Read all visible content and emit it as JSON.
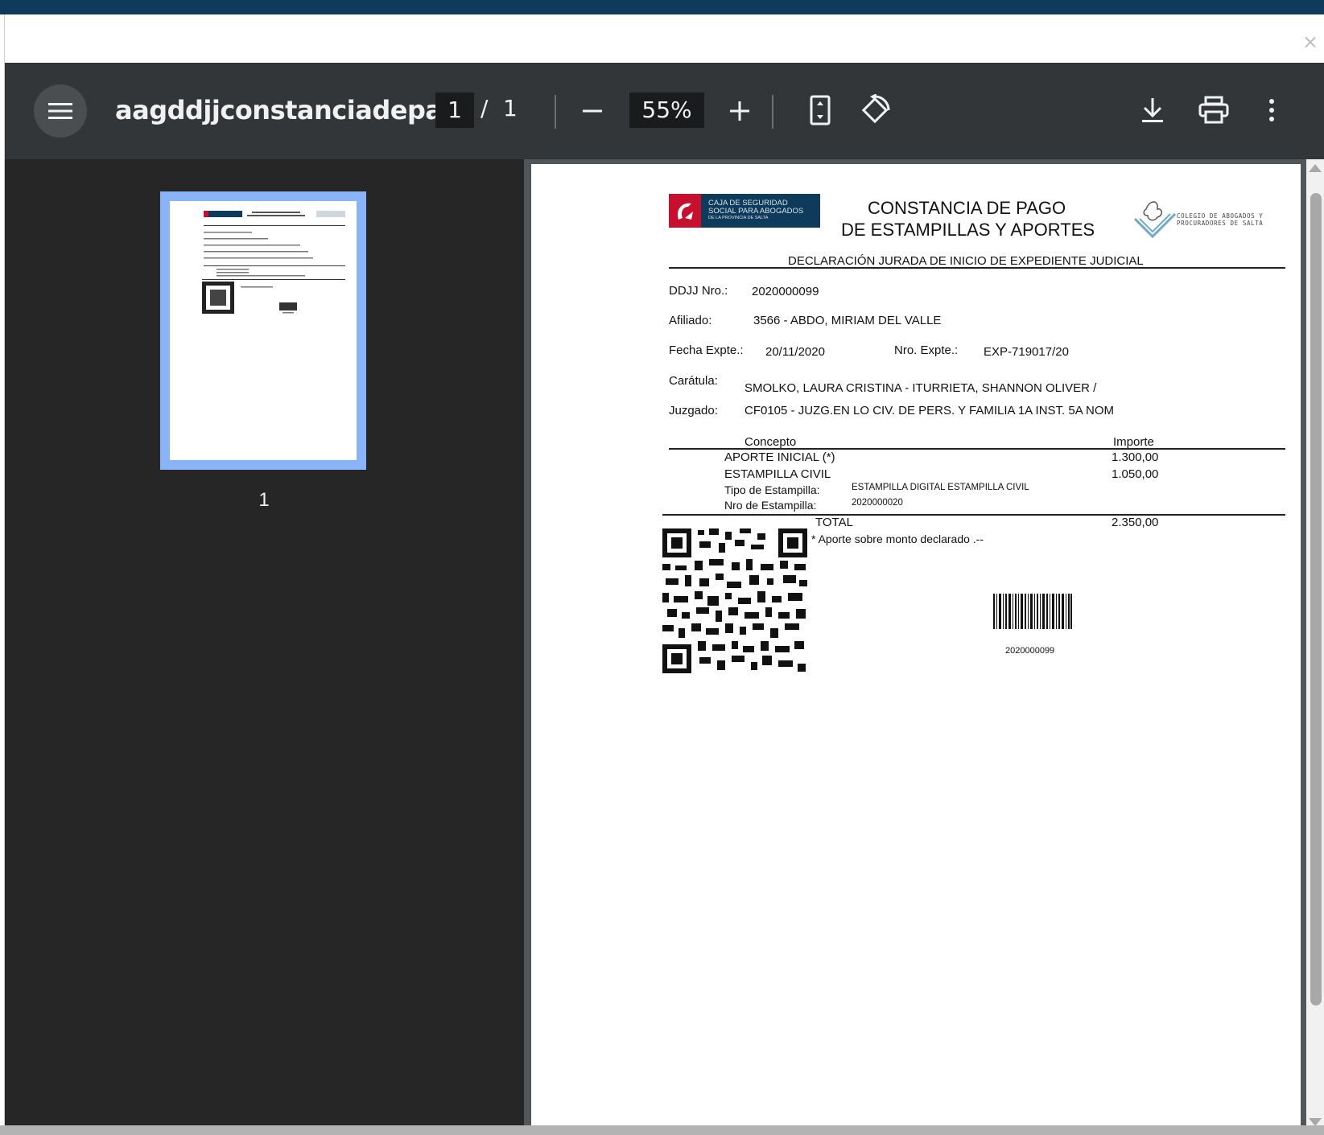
{
  "viewer": {
    "title": "aagddjjconstanciadepa...",
    "current_page": "1",
    "page_separator": "/",
    "total_pages": "1",
    "zoom": "55%",
    "icons": {
      "menu": "menu-icon",
      "zoom_out": "minus-icon",
      "zoom_in": "plus-icon",
      "fit": "fit-to-page-icon",
      "rotate": "rotate-icon",
      "download": "download-icon",
      "print": "print-icon",
      "more": "more-vertical-icon",
      "close": "close-icon"
    },
    "modal_close": "×"
  },
  "sidebar": {
    "thumbnail_label": "1"
  },
  "document": {
    "logo_left_text": [
      "CAJA DE SEGURIDAD",
      "SOCIAL PARA ABOGADOS",
      "DE LA PROVINCIA DE SALTA"
    ],
    "heading_line1": "CONSTANCIA DE PAGO",
    "heading_line2": "DE ESTAMPILLAS Y APORTES",
    "logo_right_text": [
      "COLEGIO DE ABOGADOS Y",
      "PROCURADORES DE SALTA"
    ],
    "subtitle": "DECLARACIÓN JURADA DE INICIO DE EXPEDIENTE JUDICIAL",
    "ddjj_label": "DDJJ Nro.:",
    "ddjj_value": "2020000099",
    "afiliado_label": "Afiliado:",
    "afiliado_value": "3566 - ABDO, MIRIAM DEL VALLE",
    "fecha_label": "Fecha Expte.:",
    "fecha_value": "20/11/2020",
    "nro_expte_label": "Nro. Expte.:",
    "nro_expte_value": "EXP-719017/20",
    "caratula_label": "Carátula:",
    "caratula_value": "SMOLKO, LAURA CRISTINA - ITURRIETA, SHANNON OLIVER /",
    "juzgado_label": "Juzgado:",
    "juzgado_value": "CF0105 - JUZG.EN LO CIV. DE PERS. Y FAMILIA 1A INST. 5A NOM",
    "concepto_header": "Concepto",
    "importe_header": "Importe",
    "items": [
      {
        "concepto": "APORTE INICIAL (*)",
        "importe": "1.300,00"
      },
      {
        "concepto": "ESTAMPILLA CIVIL",
        "importe": "1.050,00"
      }
    ],
    "tipo_label": "Tipo de Estampilla:",
    "tipo_value": "ESTAMPILLA DIGITAL ESTAMPILLA CIVIL",
    "nro_estampilla_label": "Nro de Estampilla:",
    "nro_estampilla_value": "2020000020",
    "total_label": "TOTAL",
    "total_value": "2.350,00",
    "note": "* Aporte sobre monto declarado .--",
    "barcode_number": "2020000099"
  }
}
